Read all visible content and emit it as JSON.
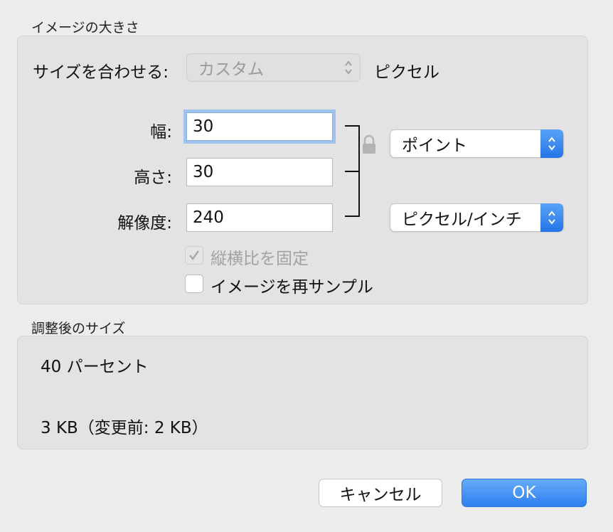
{
  "image_size": {
    "title": "イメージの大きさ",
    "fit_label": "サイズを合わせる:",
    "fit_value": "カスタム",
    "fit_unit": "ピクセル",
    "width_label": "幅:",
    "width_value": "30",
    "height_label": "高さ:",
    "height_value": "30",
    "resolution_label": "解像度:",
    "resolution_value": "240",
    "size_unit": "ポイント",
    "resolution_unit": "ピクセル/インチ",
    "constrain_label": "縦横比を固定",
    "constrain_checked": true,
    "resample_label": "イメージを再サンプル",
    "resample_checked": false
  },
  "resulting_size": {
    "title": "調整後のサイズ",
    "percent": "40 パーセント",
    "filesize": "3 KB（変更前: 2 KB）"
  },
  "buttons": {
    "cancel": "キャンセル",
    "ok": "OK"
  },
  "colors": {
    "accent": "#2e7ff0",
    "focus_ring": "#9fc3ef"
  }
}
